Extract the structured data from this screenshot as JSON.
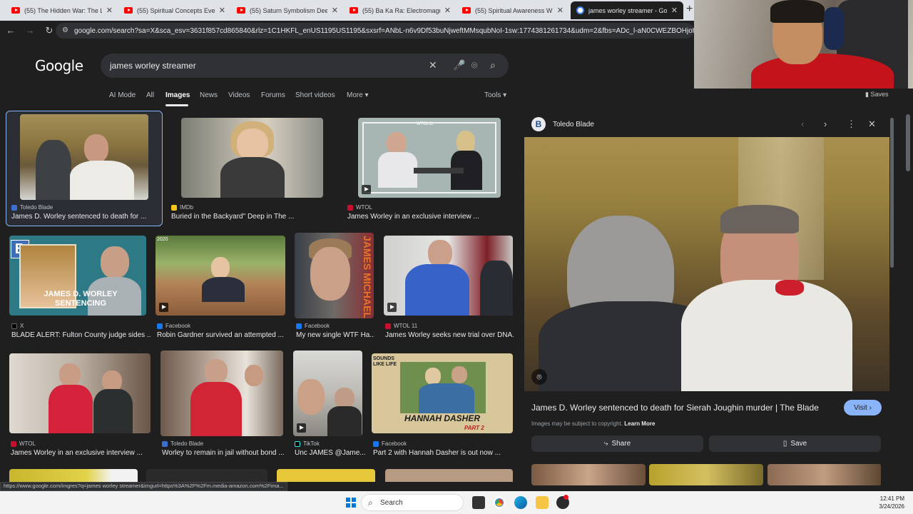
{
  "browser": {
    "tabs": [
      {
        "title": "(55) The Hidden War: The Loos"
      },
      {
        "title": "(55) Spiritual Concepts Everyone"
      },
      {
        "title": "(55) Saturn Symbolism Deep Di"
      },
      {
        "title": "(55) Ba Ka Ra: Electromagnetic"
      },
      {
        "title": "(55) Spiritual Awareness Will Re"
      },
      {
        "title": "james worley streamer - Googl"
      }
    ],
    "new_tab": "+",
    "close_glyph": "✕",
    "url": "google.com/search?sa=X&sca_esv=3631f857cd865840&rlz=1C1HKFL_enUS1195US1195&sxsrf=ANbL-n6v9Df53buNjweftMMsqubNoI-1sw:1774381261734&udm=2&fbs=ADc_l-aN0CWEZBOHjofHoaMMDiKpaEW"
  },
  "search": {
    "logo": "Google",
    "query": "james worley streamer",
    "tabs": [
      "AI Mode",
      "All",
      "Images",
      "News",
      "Videos",
      "Forums",
      "Short videos",
      "More ▾",
      "Tools ▾"
    ],
    "saves": "Saves"
  },
  "results": [
    {
      "source": "Toledo Blade",
      "caption": "James D. Worley sentenced to death for ..."
    },
    {
      "source": "IMDb",
      "caption": "Buried in the Backyard\" Deep in The ..."
    },
    {
      "source": "WTOL",
      "caption": "James Worley in an exclusive interview ..."
    },
    {
      "source": "X",
      "caption": "BLADE ALERT: Fulton County judge sides ..."
    },
    {
      "source": "Facebook",
      "caption": "Robin Gardner survived an attempted ..."
    },
    {
      "source": "Facebook",
      "caption": "My new single WTF Ha..."
    },
    {
      "source": "WTOL 11",
      "caption": "James Worley seeks new trial over DNA..."
    },
    {
      "source": "WTOL",
      "caption": "James Worley in an exclusive interview ..."
    },
    {
      "source": "Toledo Blade",
      "caption": "Worley to remain in jail without bond ..."
    },
    {
      "source": "TikTok",
      "caption": "Unc JAMES @Jame..."
    },
    {
      "source": "Facebook",
      "caption": "Part 2 with Hannah Dasher is out now ..."
    }
  ],
  "thumb_text": {
    "blade_b": "B",
    "sentencing": "JAMES D. WORLEY\nSENTENCING",
    "year": "2020",
    "james_michael": "JAMES MICHAEL",
    "wtol": "WTOL11",
    "hannah": "HANNAH DASHER",
    "part2": "PART 2",
    "sounds": "SOUNDS LIKE LIFE"
  },
  "panel": {
    "source": "Toledo Blade",
    "logo_letter": "B",
    "title": "James D. Worley sentenced to death for Sierah Joughin murder | The Blade",
    "visit": "Visit ›",
    "copyright": "Images may be subject to copyright.",
    "learn_more": "Learn More",
    "share": "Share",
    "save": "Save"
  },
  "status_url": "https://www.google.com/imgres?q=james worley streamer&imgurl=https%3A%2F%2Fm.media-amazon.com%2Fima...",
  "taskbar": {
    "search": "Search",
    "time": "12:41 PM",
    "date": "3/24/2026"
  }
}
